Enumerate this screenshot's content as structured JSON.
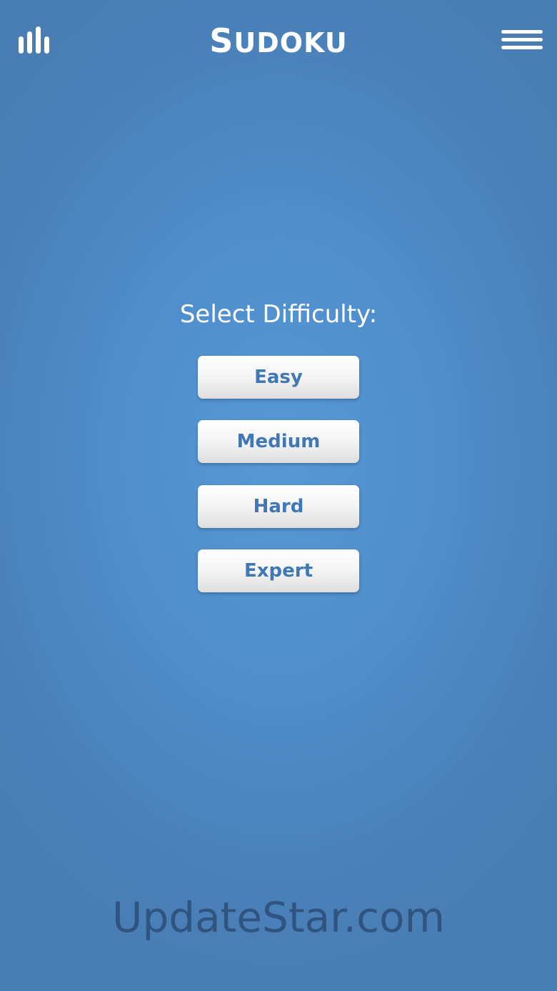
{
  "header": {
    "title_initial": "S",
    "title_rest": "UDOKU",
    "stats_icon": "bar-chart-icon",
    "menu_icon": "hamburger-menu-icon"
  },
  "main": {
    "prompt": "Select Difficulty:",
    "buttons": [
      {
        "label": "Easy"
      },
      {
        "label": "Medium"
      },
      {
        "label": "Hard"
      },
      {
        "label": "Expert"
      }
    ]
  },
  "watermark": "UpdateStar.com",
  "colors": {
    "background": "#4f8ccb",
    "button_text": "#3f78b4",
    "header_text": "#ffffff"
  }
}
